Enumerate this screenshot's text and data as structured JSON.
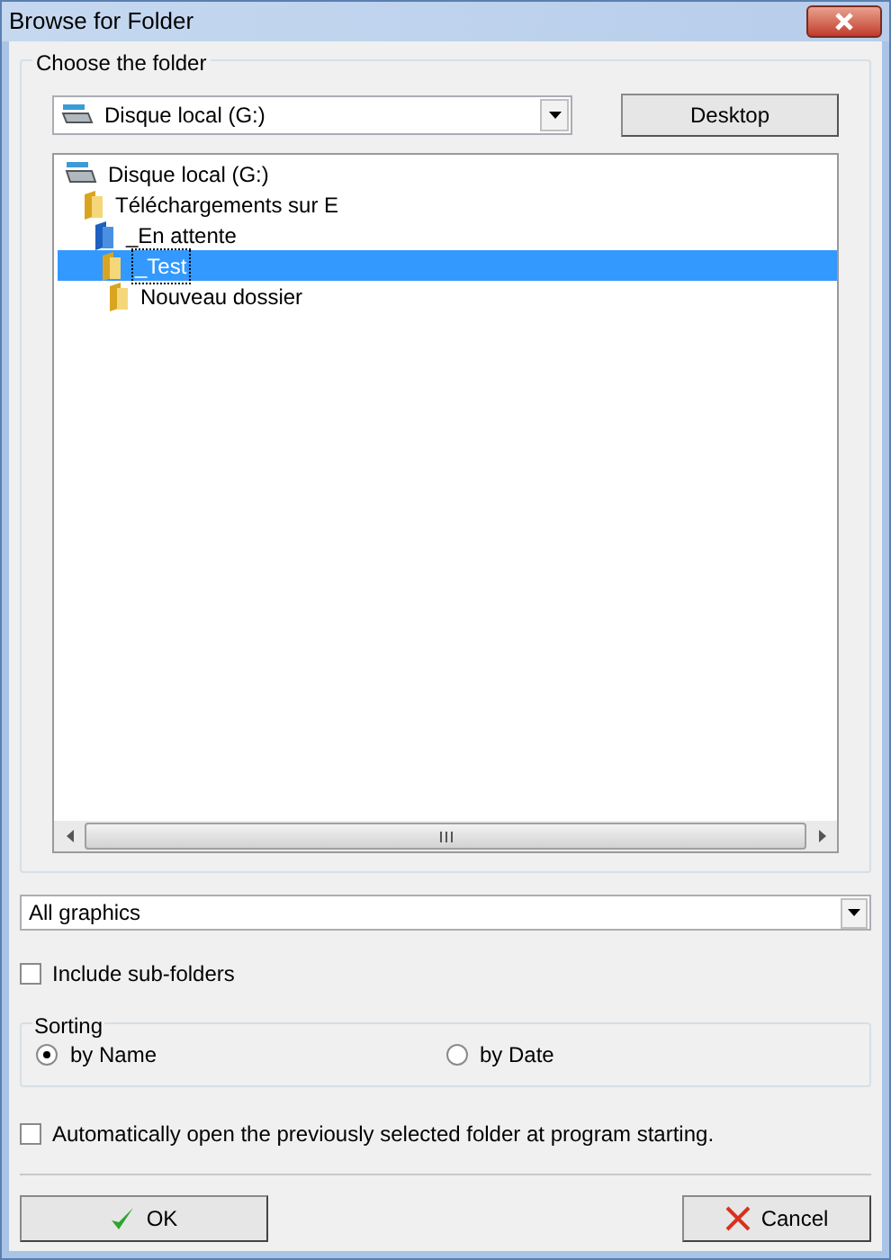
{
  "window": {
    "title": "Browse for Folder"
  },
  "folder_group": {
    "title": "Choose the folder",
    "drive_combo": {
      "value": "Disque local (G:)"
    },
    "desktop_button": "Desktop",
    "tree": [
      {
        "label": "Disque local (G:)",
        "kind": "drive",
        "selected": false,
        "children": [
          {
            "label": "Téléchargements sur E",
            "kind": "folder",
            "selected": false,
            "children": [
              {
                "label": "_En attente",
                "kind": "folder-blue",
                "selected": false,
                "children": [
                  {
                    "label": "_Test",
                    "kind": "folder",
                    "selected": true,
                    "children": [
                      {
                        "label": "Nouveau dossier",
                        "kind": "folder",
                        "selected": false
                      }
                    ]
                  }
                ]
              }
            ]
          }
        ]
      }
    ]
  },
  "filter_combo": {
    "value": "All graphics"
  },
  "include_subfolders": {
    "label": "Include sub-folders",
    "checked": false
  },
  "sorting": {
    "title": "Sorting",
    "options": [
      {
        "label": "by Name",
        "selected": true
      },
      {
        "label": "by Date",
        "selected": false
      }
    ]
  },
  "auto_open": {
    "label": "Automatically open the previously selected folder at program starting.",
    "checked": false
  },
  "buttons": {
    "ok": "OK",
    "cancel": "Cancel"
  }
}
